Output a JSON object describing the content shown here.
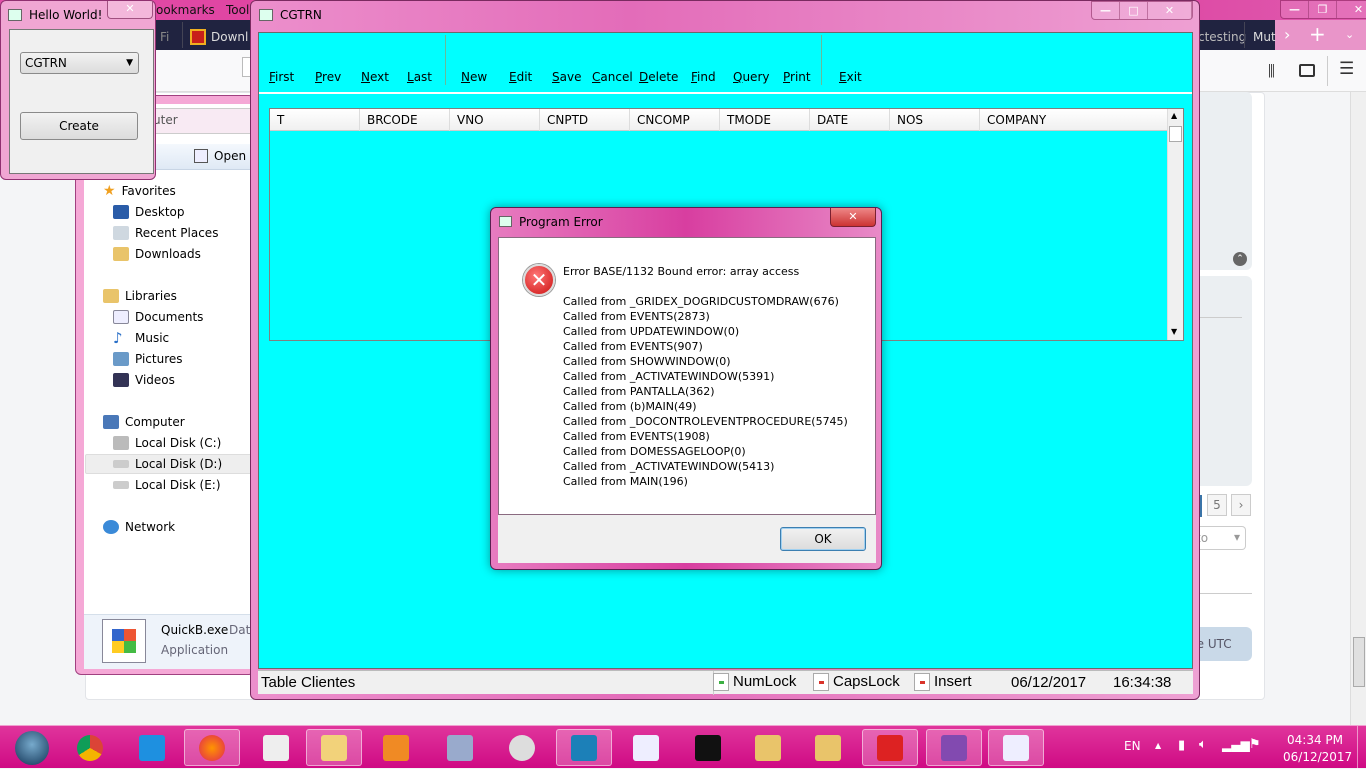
{
  "firefox": {
    "menu": [
      "ookmarks",
      "Tool"
    ],
    "tabs": [
      "Fi",
      "Downl",
      "ctesting",
      "Mut"
    ],
    "pagination_page": "5",
    "dropdown_partial": "to",
    "utc_label_partial": "re UTC"
  },
  "explorer": {
    "breadcrumb": "Computer",
    "open_label": "Open",
    "nav": {
      "favorites": "Favorites",
      "favorites_items": [
        "Desktop",
        "Recent Places",
        "Downloads"
      ],
      "libraries": "Libraries",
      "libraries_items": [
        "Documents",
        "Music",
        "Pictures",
        "Videos"
      ],
      "computer": "Computer",
      "computer_items": [
        "Local Disk (C:)",
        "Local Disk (D:)",
        "Local Disk (E:)"
      ],
      "network": "Network"
    },
    "details": {
      "name": "QuickB.exe",
      "date_partial": "Date",
      "type": "Application"
    }
  },
  "hello": {
    "title": "Hello World!",
    "select_value": "CGTRN",
    "create_label": "Create"
  },
  "cgtrn": {
    "title": "CGTRN",
    "toolbar": [
      "First",
      "Prev",
      "Next",
      "Last",
      "New",
      "Edit",
      "Save",
      "Cancel",
      "Delete",
      "Find",
      "Query",
      "Print",
      "Exit"
    ],
    "columns": [
      "T",
      "BRCODE",
      "VNO",
      "CNPTD",
      "CNCOMP",
      "TMODE",
      "DATE",
      "NOS",
      "COMPANY"
    ],
    "status": {
      "table": "Table Clientes",
      "numlock": "NumLock",
      "capslock": "CapsLock",
      "insert": "Insert",
      "date": "06/12/2017",
      "time": "16:34:38",
      "numlock_color": "#3cb043",
      "off_color": "#d9342b"
    }
  },
  "dialog": {
    "title": "Program Error",
    "message": "Error BASE/1132  Bound error: array access",
    "trace": [
      "Called from _GRIDEX_DOGRIDCUSTOMDRAW(676)",
      "Called from EVENTS(2873)",
      "Called from UPDATEWINDOW(0)",
      "Called from EVENTS(907)",
      "Called from SHOWWINDOW(0)",
      "Called from _ACTIVATEWINDOW(5391)",
      "Called from PANTALLA(362)",
      "Called from (b)MAIN(49)",
      "Called from _DOCONTROLEVENTPROCEDURE(5745)",
      "Called from EVENTS(1908)",
      "Called from DOMESSAGELOOP(0)",
      "Called from _ACTIVATEWINDOW(5413)",
      "Called from MAIN(196)"
    ],
    "ok_label": "OK"
  },
  "taskbar": {
    "apps": [
      "start",
      "chrome",
      "internet-explorer",
      "firefox",
      "document-viewer",
      "file-explorer",
      "media-player",
      "calculator",
      "disc-burner",
      "hmg-ide",
      "app-window",
      "command-prompt",
      "folder",
      "folder",
      "c-app",
      "winrar",
      "app-window"
    ],
    "language": "EN",
    "time": "04:34 PM",
    "date": "06/12/2017"
  }
}
